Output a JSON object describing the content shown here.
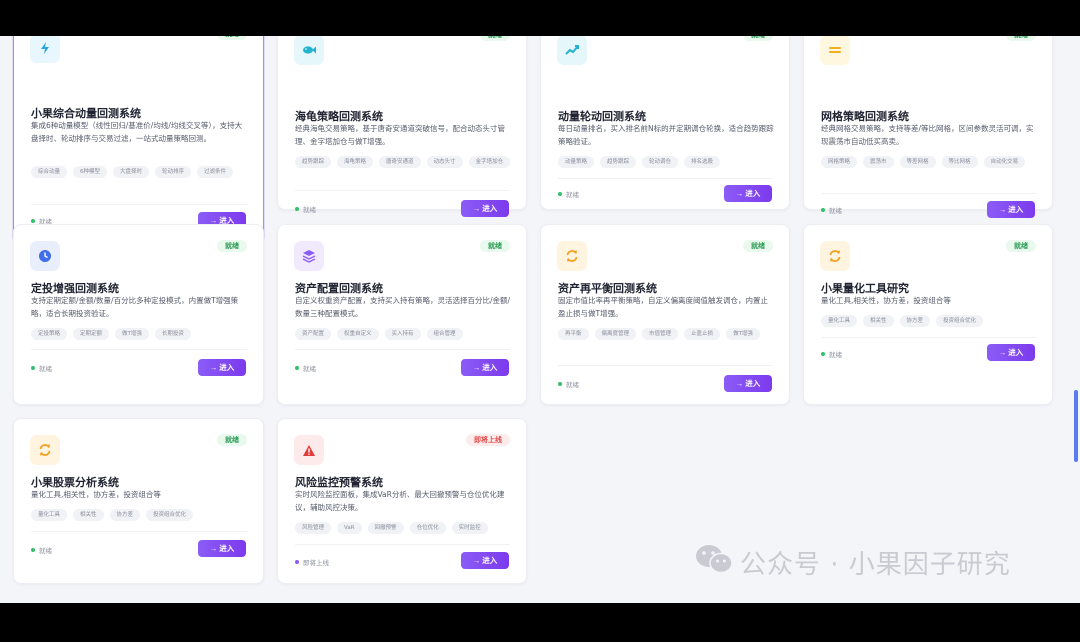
{
  "enter_label": "进入",
  "cards": [
    {
      "title": "小果综合动量回测系统",
      "badge": "就绪",
      "status": "就绪",
      "icon": "bolt-icon",
      "desc": "集成6种动量模型（线性回归/基准价/均线/均线交叉等），支持大盘择时、轮动排序与交易过滤，一站式动量策略回测。",
      "tags": [
        "综合动量",
        "6种模型",
        "大盘择时",
        "轮动排序",
        "过滤条件"
      ]
    },
    {
      "title": "海龟策略回测系统",
      "badge": "就绪",
      "status": "就绪",
      "icon": "fish-icon",
      "desc": "经典海龟交易策略，基于唐奇安通道突破信号，配合动态头寸管理、金字塔加仓与做T增强。",
      "tags": [
        "趋势跟踪",
        "海龟策略",
        "唐奇安通道",
        "动态头寸",
        "金字塔加仓"
      ]
    },
    {
      "title": "动量轮动回测系统",
      "badge": "就绪",
      "status": "就绪",
      "icon": "trend-up-icon",
      "desc": "每日动量排名，买入排名前N标的并定期调仓轮换，适合趋势跟踪策略验证。",
      "tags": [
        "动量策略",
        "趋势跟踪",
        "轮动调仓",
        "排名选股"
      ]
    },
    {
      "title": "网格策略回测系统",
      "badge": "就绪",
      "status": "就绪",
      "icon": "grid-lines-icon",
      "desc": "经典网格交易策略，支持等差/等比网格，区间参数灵活可调，实现震荡市自动低买高卖。",
      "tags": [
        "网格策略",
        "震荡市",
        "等差网格",
        "等比网格",
        "自动化交易"
      ]
    },
    {
      "title": "定投增强回测系统",
      "badge": "就绪",
      "status": "就绪",
      "icon": "clock-icon",
      "desc": "支持定期定额/金额/数量/百分比多种定投模式，内置做T增强策略，适合长期投资验证。",
      "tags": [
        "定投策略",
        "定期定额",
        "做T增强",
        "长期投资"
      ]
    },
    {
      "title": "资产配置回测系统",
      "badge": "就绪",
      "status": "就绪",
      "icon": "layers-icon",
      "desc": "自定义权重资产配置，支持买入持有策略，灵活选择百分比/金额/数量三种配置模式。",
      "tags": [
        "资产配置",
        "权重自定义",
        "买入持有",
        "组合管理"
      ]
    },
    {
      "title": "资产再平衡回测系统",
      "badge": "就绪",
      "status": "就绪",
      "icon": "refresh-icon",
      "desc": "固定市值比率再平衡策略，自定义偏离度阈值触发调仓，内置止盈止损与做T增强。",
      "tags": [
        "再平衡",
        "偏离度管理",
        "市值管理",
        "止盈止损",
        "做T增强"
      ]
    },
    {
      "title": "小果量化工具研究",
      "badge": "就绪",
      "status": "就绪",
      "icon": "refresh-icon",
      "desc": "量化工具,相关性，协方差，投资组合等",
      "tags": [
        "量化工具",
        "相关性",
        "协方差",
        "投资组合优化"
      ]
    },
    {
      "title": "小果股票分析系统",
      "badge": "就绪",
      "status": "就绪",
      "icon": "refresh-icon",
      "desc": "量化工具,相关性，协方差，投资组合等",
      "tags": [
        "量化工具",
        "相关性",
        "协方差",
        "投资组合优化"
      ]
    },
    {
      "title": "风险监控预警系统",
      "badge": "即将上线",
      "status": "即将上线",
      "icon": "warning-icon",
      "desc": "实时风险监控面板，集成VaR分析、最大回撤预警与仓位优化建议，辅助风控决策。",
      "tags": [
        "风险管理",
        "VaR",
        "回撤预警",
        "仓位优化",
        "实时监控"
      ]
    }
  ],
  "watermark": {
    "text": "公众号 · 小果因子研究",
    "icon": "wechat-icon"
  },
  "colors": {
    "accent": "#7c3aed",
    "ready": "#2f9e57",
    "soon": "#e04848"
  }
}
